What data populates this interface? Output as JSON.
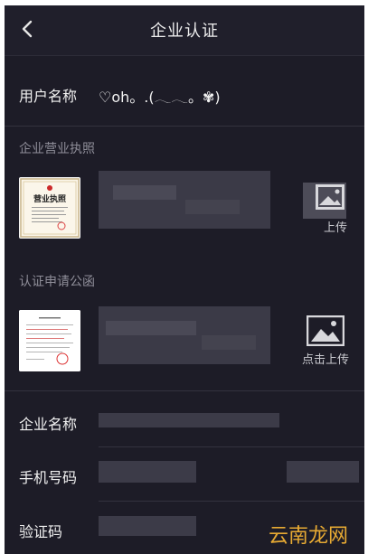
{
  "header": {
    "title": "企业认证",
    "back_icon": "chevron-left-icon"
  },
  "user": {
    "label": "用户名称",
    "value": "♡oh。.(⁠𓂃𓂃⁠。✾)"
  },
  "license": {
    "section": "企业营业执照",
    "thumb_title": "营业执照",
    "upload_label": "上传"
  },
  "letter": {
    "section": "认证申请公函",
    "upload_label": "点击上传"
  },
  "company": {
    "label": "企业名称"
  },
  "phone": {
    "label": "手机号码"
  },
  "code": {
    "label": "验证码"
  },
  "watermark": "云南龙网",
  "colors": {
    "background": "#1d1c27",
    "accent_watermark": "#e7aa33"
  }
}
